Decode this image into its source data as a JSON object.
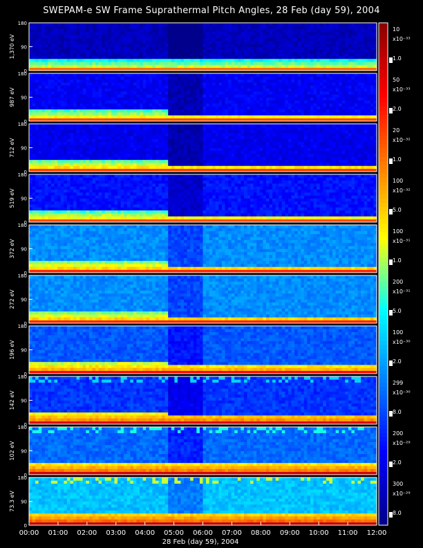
{
  "title": "SWEPAM-e SW Frame Suprathermal Pitch Angles, 28 Feb (day  59), 2004",
  "colors": {
    "background": "#000000",
    "text": "#ffffff",
    "colormap": [
      "#00008b",
      "#0000ff",
      "#0080ff",
      "#00ffff",
      "#ffff00",
      "#ff8000",
      "#ff0000",
      "#8b0000"
    ]
  },
  "chart_data": {
    "type": "heatmap",
    "xlabel": "28 Feb (day  59), 2004",
    "x_tick_labels": [
      "00:00",
      "01:00",
      "02:00",
      "03:00",
      "04:00",
      "05:00",
      "06:00",
      "07:00",
      "08:00",
      "09:00",
      "10:00",
      "11:00",
      "12:00"
    ],
    "x_range_hours": [
      0,
      12
    ],
    "y_tick_labels": [
      "0",
      "90",
      "180"
    ],
    "y_range_degrees": [
      0,
      180
    ],
    "panels": [
      {
        "energy_label": "1,370 eV",
        "scale_top": "10",
        "scale_mult": "x10⁻³³",
        "scale_low": "1.0",
        "bg": 0.06,
        "band": 0.62,
        "step": 0.0
      },
      {
        "energy_label": "987 eV",
        "scale_top": "50",
        "scale_mult": "x10⁻³³",
        "scale_low": "2.0",
        "bg": 0.13,
        "band": 0.66,
        "step": 0.05
      },
      {
        "energy_label": "712 eV",
        "scale_top": "20",
        "scale_mult": "x10⁻³²",
        "scale_low": "1.0",
        "bg": 0.12,
        "band": 0.68,
        "step": 0.05
      },
      {
        "energy_label": "519 eV",
        "scale_top": "100",
        "scale_mult": "x10⁻³²",
        "scale_low": "5.0",
        "bg": 0.16,
        "band": 0.66,
        "step": 0.06
      },
      {
        "energy_label": "372 eV",
        "scale_top": "100",
        "scale_mult": "x10⁻³¹",
        "scale_low": "1.0",
        "bg": 0.3,
        "band": 0.7,
        "step": 0.05
      },
      {
        "energy_label": "272 eV",
        "scale_top": "200",
        "scale_mult": "x10⁻³¹",
        "scale_low": "5.0",
        "bg": 0.3,
        "band": 0.7,
        "step": 0.05
      },
      {
        "energy_label": "196 eV",
        "scale_top": "100",
        "scale_mult": "x10⁻³⁰",
        "scale_low": "2.0",
        "bg": 0.24,
        "band": 0.74,
        "step": 0.03
      },
      {
        "energy_label": "142 eV",
        "scale_top": "299",
        "scale_mult": "x10⁻³⁰",
        "scale_low": "8.0",
        "bg": 0.2,
        "band": 0.78,
        "step": 0.02
      },
      {
        "energy_label": "102 eV",
        "scale_top": "200",
        "scale_mult": "x10⁻²⁹",
        "scale_low": "2.0",
        "bg": 0.26,
        "band": 0.8,
        "step": 0.0
      },
      {
        "energy_label": "73.3 eV",
        "scale_top": "300",
        "scale_mult": "x10⁻²⁹",
        "scale_low": "8.0",
        "bg": 0.36,
        "band": 0.82,
        "step": 0.0
      }
    ]
  }
}
